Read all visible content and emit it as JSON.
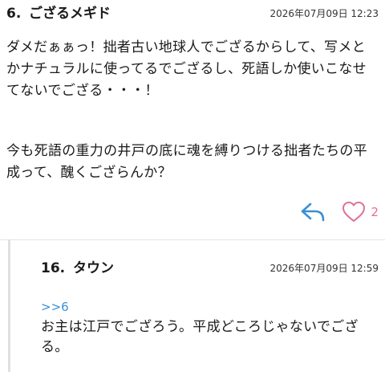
{
  "post": {
    "number": "6.",
    "author": "ござるメギド",
    "date": "2026年07月09日 12:23",
    "paragraphs": [
      "ダメだぁぁっ！拙者古い地球人でござるからして、写メとかナチュラルに使ってるでござるし、死語しか使いこなせてないでござる・・・！",
      "今も死語の重力の井戸の底に魂を縛りつける拙者たちの平成って、醜くござらんか？"
    ],
    "like_count": "2",
    "icons": {
      "reply": "reply-arrow-icon",
      "like": "heart-outline-icon"
    }
  },
  "reply": {
    "number": "16.",
    "author": "タウン",
    "date": "2026年07月09日 12:59",
    "anchor": ">>6",
    "body": "お主は江戸でござろう。平成どころじゃないでござる。"
  },
  "colors": {
    "accent_blue": "#3a8fd6",
    "like_pink": "#e0709a",
    "divider": "#e4e4e4"
  }
}
